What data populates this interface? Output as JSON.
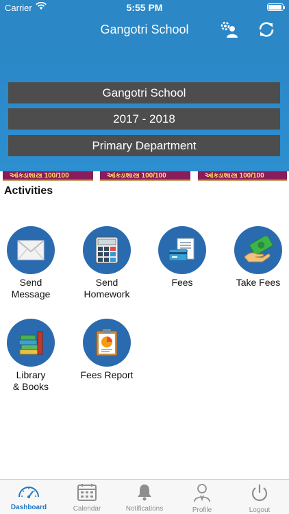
{
  "status_bar": {
    "carrier": "Carrier",
    "time": "5:55 PM"
  },
  "nav": {
    "title": "Gangotri School",
    "settings_icon": "user-settings-icon",
    "refresh_icon": "refresh-icon"
  },
  "selectors": {
    "school": "Gangotri School",
    "year": "2017 - 2018",
    "department": "Primary Department"
  },
  "banner": {
    "items": [
      "આંકડાશાસ્ત્ર 100/100",
      "આંકડાશાસ્ત્ર 100/100",
      "આંકડાશાસ્ત્ર 100/100"
    ]
  },
  "activities": {
    "title": "Activities",
    "items": [
      {
        "label": "Send\nMessage",
        "icon": "envelope-icon"
      },
      {
        "label": "Send\nHomework",
        "icon": "calculator-icon"
      },
      {
        "label": "Fees",
        "icon": "invoice-card-icon"
      },
      {
        "label": "Take Fees",
        "icon": "cash-hand-icon"
      },
      {
        "label": "Library\n& Books",
        "icon": "books-icon"
      },
      {
        "label": "Fees Report",
        "icon": "report-clipboard-icon"
      }
    ]
  },
  "tabbar": {
    "items": [
      {
        "label": "Dashboard",
        "icon": "speedometer-icon",
        "active": true
      },
      {
        "label": "Calendar",
        "icon": "calendar-icon",
        "active": false
      },
      {
        "label": "Notifications",
        "icon": "bell-icon",
        "active": false
      },
      {
        "label": "Profile",
        "icon": "profile-icon",
        "active": false
      },
      {
        "label": "Logout",
        "icon": "power-icon",
        "active": false
      }
    ]
  },
  "colors": {
    "primary_blue": "#2b87c6",
    "selector_gray": "#4d4d4d",
    "activity_circle": "#2a6bb0",
    "tab_active": "#2277c4",
    "tab_inactive": "#8e8e8e"
  }
}
